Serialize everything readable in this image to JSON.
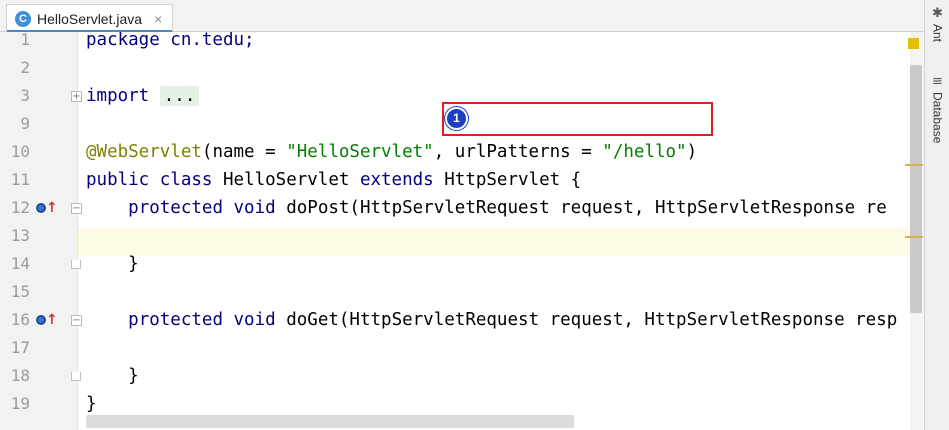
{
  "tab": {
    "label": "HelloServlet.java",
    "close": "×",
    "icon": "C"
  },
  "right_toolbar": [
    {
      "label": "Ant",
      "icon": "ant-icon"
    },
    {
      "label": "Database",
      "icon": "database-icon"
    }
  ],
  "lines": [
    {
      "num": "1"
    },
    {
      "num": "2"
    },
    {
      "num": "3"
    },
    {
      "num": "9"
    },
    {
      "num": "10"
    },
    {
      "num": "11"
    },
    {
      "num": "12"
    },
    {
      "num": "13"
    },
    {
      "num": "14"
    },
    {
      "num": "15"
    },
    {
      "num": "16"
    },
    {
      "num": "17"
    },
    {
      "num": "18"
    },
    {
      "num": "19"
    }
  ],
  "code": {
    "l1": "package cn.tedu;",
    "l3_kw": "import",
    "l3_fold": "...",
    "l10_ann": "@WebServlet",
    "l10_a": "(name = ",
    "l10_s1": "\"HelloServlet\"",
    "l10_b": ", urlPatterns = ",
    "l10_s2": "\"/hello\"",
    "l10_c": ")",
    "l11_kw1": "public class",
    "l11_a": " HelloServlet ",
    "l11_kw2": "extends",
    "l11_b": " HttpServlet {",
    "l12_indent": "    ",
    "l12_kw": "protected void",
    "l12_a": " doPost(HttpServletRequest request, HttpServletResponse re",
    "l14": "    }",
    "l16_indent": "    ",
    "l16_kw": "protected void",
    "l16_a": " doGet(HttpServletRequest request, HttpServletResponse resp",
    "l18": "    }",
    "l19": "}"
  },
  "callout": {
    "number": "1"
  },
  "colors": {
    "keyword": "#000080",
    "string": "#008000",
    "annotation": "#808000",
    "callout_border": "#e02020",
    "badge": "#1d3fc2"
  }
}
